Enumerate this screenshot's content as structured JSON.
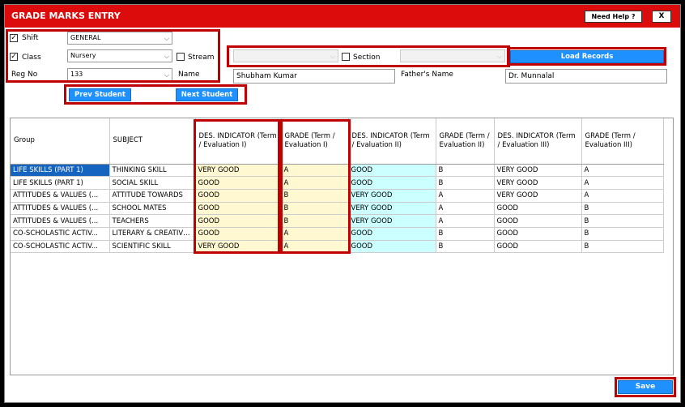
{
  "window": {
    "title": "GRADE MARKS ENTRY",
    "help_label": "Need Help ?",
    "close_label": "X"
  },
  "form": {
    "shift_label": "Shift",
    "shift_checked": true,
    "shift_value": "GENERAL",
    "class_label": "Class",
    "class_checked": true,
    "class_value": "Nursery",
    "stream_label": "Stream",
    "stream_checked": false,
    "regno_label": "Reg No",
    "regno_value": "133",
    "name_label": "Name",
    "name_value": "Shubham Kumar",
    "section_label": "Section",
    "section_checked": false,
    "father_label": "Father's Name",
    "father_value": "Dr. Munnalal",
    "load_label": "Load Records",
    "prev_label": "Prev Student",
    "next_label": "Next Student",
    "save_label": "Save"
  },
  "grid": {
    "headers": [
      "Group",
      "SUBJECT",
      "DES.  INDICATOR (Term / Evaluation I)",
      "GRADE (Term / Evaluation I)",
      "DES.  INDICATOR (Term / Evaluation II)",
      "GRADE (Term / Evaluation II)",
      "DES.  INDICATOR (Term / Evaluation III)",
      "GRADE (Term / Evaluation III)"
    ],
    "rows": [
      [
        "LIFE SKILLS (PART 1)",
        "THINKING SKILL",
        "VERY GOOD",
        "A",
        "GOOD",
        "B",
        "VERY GOOD",
        "A"
      ],
      [
        "LIFE SKILLS (PART 1)",
        "SOCIAL SKILL",
        "GOOD",
        "A",
        "GOOD",
        "B",
        "VERY GOOD",
        "A"
      ],
      [
        "ATTITUDES & VALUES (...",
        "ATTITUDE TOWARDS",
        "GOOD",
        "B",
        "VERY GOOD",
        "A",
        "VERY GOOD",
        "A"
      ],
      [
        "ATTITUDES & VALUES (...",
        "SCHOOL MATES",
        "GOOD",
        "B",
        "VERY GOOD",
        "A",
        "GOOD",
        "B"
      ],
      [
        "ATTITUDES & VALUES (...",
        "TEACHERS",
        "GOOD",
        "B",
        "VERY GOOD",
        "A",
        "GOOD",
        "B"
      ],
      [
        "CO-SCHOLASTIC ACTIV...",
        "LITERARY & CREATIVE ...",
        "GOOD",
        "A",
        "GOOD",
        "B",
        "GOOD",
        "B"
      ],
      [
        "CO-SCHOLASTIC ACTIV...",
        "SCIENTIFIC SKILL",
        "VERY GOOD",
        "A",
        "GOOD",
        "B",
        "GOOD",
        "B"
      ]
    ]
  },
  "colors": {
    "title_bar": "#dd0c0c",
    "accent_button": "#1e90ff",
    "highlight_box": "#c00000",
    "term1_cells": "#fff8d0",
    "term2_cells": "#ccffff",
    "selected_cell": "#1565c0"
  }
}
